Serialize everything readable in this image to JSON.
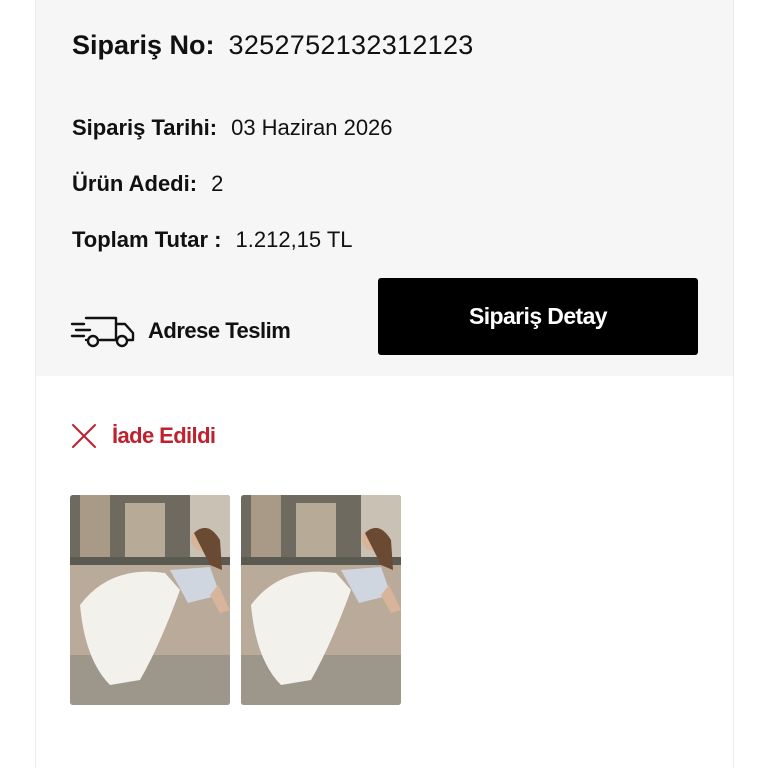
{
  "order": {
    "number_label": "Sipariş No:",
    "number_value": "3252752132312123",
    "date_label": "Sipariş Tarihi:",
    "date_value": "03 Haziran 2026",
    "count_label": "Ürün Adedi:",
    "count_value": "2",
    "total_label": "Toplam Tutar :",
    "total_value": "1.212,15 TL"
  },
  "delivery": {
    "icon": "delivery-truck-icon",
    "label": "Adrese Teslim"
  },
  "actions": {
    "detail_label": "Sipariş Detay"
  },
  "status": {
    "icon": "close-icon",
    "label": "İade Edildi",
    "color": "#c0212f"
  },
  "products": [
    {
      "image": "product-photo-white-dress"
    },
    {
      "image": "product-photo-white-dress"
    }
  ],
  "colors": {
    "summary_bg": "#f6f6f6",
    "button_bg": "#000000",
    "button_text": "#ffffff"
  }
}
